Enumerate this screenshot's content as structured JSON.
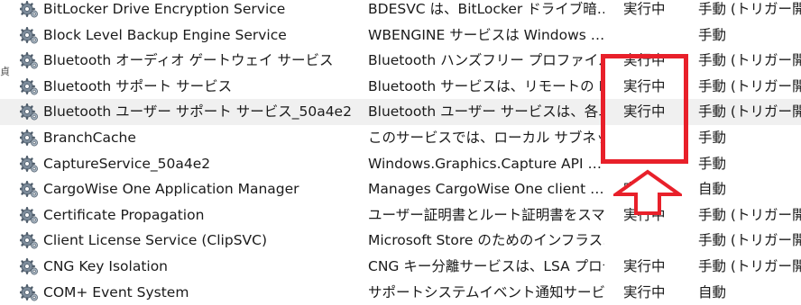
{
  "services": [
    {
      "name": "BitLocker Drive Encryption Service",
      "desc": "BDESVC は、BitLocker ドライブ暗…",
      "status": "実行中",
      "startup": "手動 (トリガー開始)",
      "selected": false
    },
    {
      "name": "Block Level Backup Engine Service",
      "desc": "WBENGINE サービスは Windows …",
      "status": "",
      "startup": "手動",
      "selected": false
    },
    {
      "name": "Bluetooth オーディオ ゲートウェイ サービス",
      "desc": "Bluetooth ハンズフリー プロファイルの…",
      "status": "実行中",
      "startup": "手動 (トリガー開始)",
      "selected": false
    },
    {
      "name": "Bluetooth サポート サービス",
      "desc": "Bluetooth サービスは、リモートの Bl…",
      "status": "実行中",
      "startup": "手動 (トリガー開始)",
      "selected": false
    },
    {
      "name": "Bluetooth ユーザー サポート サービス_50a4e2",
      "desc": "Bluetooth ユーザー サービスは、各ユ…",
      "status": "実行中",
      "startup": "手動 (トリガー開始)",
      "selected": true
    },
    {
      "name": "BranchCache",
      "desc": "このサービスでは、ローカル サブネット…",
      "status": "",
      "startup": "手動",
      "selected": false
    },
    {
      "name": "CaptureService_50a4e2",
      "desc": "Windows.Graphics.Capture API …",
      "status": "",
      "startup": "手動",
      "selected": false
    },
    {
      "name": "CargoWise One Application Manager",
      "desc": "Manages CargoWise One client …",
      "status": "実行中",
      "startup": "自動",
      "selected": false
    },
    {
      "name": "Certificate Propagation",
      "desc": "ユーザー証明書とルート証明書をスマ…",
      "status": "実行中",
      "startup": "手動 (トリガー開始)",
      "selected": false
    },
    {
      "name": "Client License Service (ClipSVC)",
      "desc": "Microsoft Store のためのインフラス…",
      "status": "",
      "startup": "手動 (トリガー開始)",
      "selected": false
    },
    {
      "name": "CNG Key Isolation",
      "desc": "CNG キー分離サービスは、LSA プロセ…",
      "status": "実行中",
      "startup": "手動 (トリガー開始)",
      "selected": false
    },
    {
      "name": "COM+ Event System",
      "desc": "サポートシステムイベント通知サービ…",
      "status": "実行中",
      "startup": "自動",
      "selected": false
    }
  ],
  "left_edge_glyph": "貞",
  "colors": {
    "annotation": "#e8202a",
    "selected_row": "#f0f0f0",
    "icon_gear": "#6b7c8c"
  },
  "icons": {
    "service": "gear-icon"
  }
}
